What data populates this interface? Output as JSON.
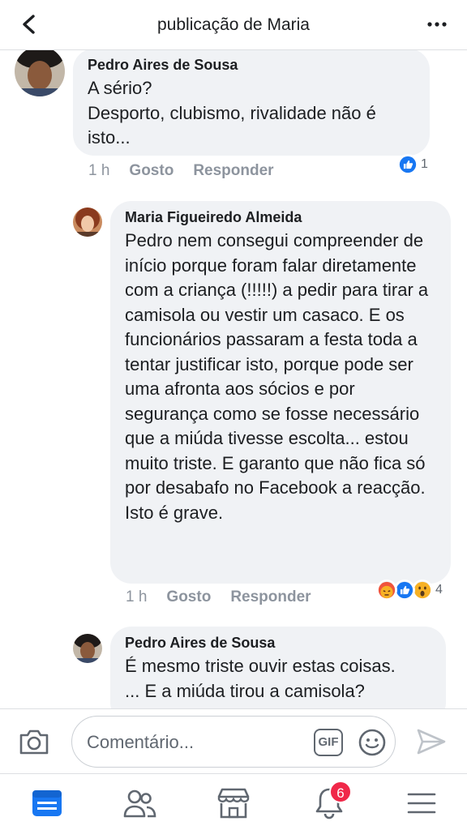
{
  "header": {
    "title": "publicação de Maria"
  },
  "comments": [
    {
      "author": "Pedro Aires de Sousa",
      "text": "A sério?\nDesporto, clubismo, rivalidade não é isto...",
      "time": "1 h",
      "like_label": "Gosto",
      "reply_label": "Responder",
      "reaction_count": "1"
    },
    {
      "author": "Maria Figueiredo Almeida",
      "text": "Pedro nem consegui compreender de início porque foram falar diretamente com a criança (!!!!!) a pedir para tirar a camisola ou vestir um casaco. E os funcionários passaram a festa toda a tentar justificar isto, porque pode ser uma afronta aos sócios e por segurança como se fosse necessário que a miúda tivesse escolta... estou muito triste. E garanto que não fica só por desabafo no Facebook a reacção. Isto é grave.",
      "time": "1 h",
      "like_label": "Gosto",
      "reply_label": "Responder",
      "reaction_count": "4"
    },
    {
      "author": "Pedro Aires de Sousa",
      "text": "É mesmo triste ouvir estas coisas.\n... E a miúda tirou a camisola?"
    }
  ],
  "composer": {
    "placeholder": "Comentário...",
    "gif_label": "GIF"
  },
  "tabbar": {
    "notifications_badge": "6"
  },
  "colors": {
    "accent": "#1877f2",
    "bubble": "#f0f2f5",
    "badge": "#f02849"
  }
}
